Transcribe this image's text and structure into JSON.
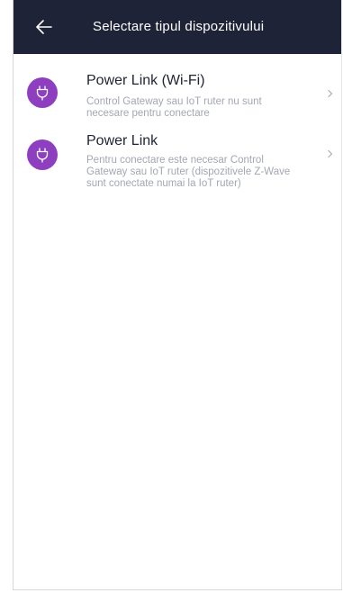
{
  "header": {
    "title": "Selectare tipul dispozitivului",
    "back_icon": "arrow-left-icon",
    "background": "#1f2338"
  },
  "accent_color": "#8e3fbf",
  "items": [
    {
      "title": "Power Link (Wi-Fi)",
      "description": "Control Gateway sau IoT ruter nu sunt necesare pentru conectare",
      "icon": "plug-icon"
    },
    {
      "title": "Power Link",
      "description": "Pentru conectare este necesar Control Gateway sau IoT ruter (dispozitivele Z-Wave sunt conectate numai la IoT ruter)",
      "icon": "plug-icon"
    }
  ]
}
